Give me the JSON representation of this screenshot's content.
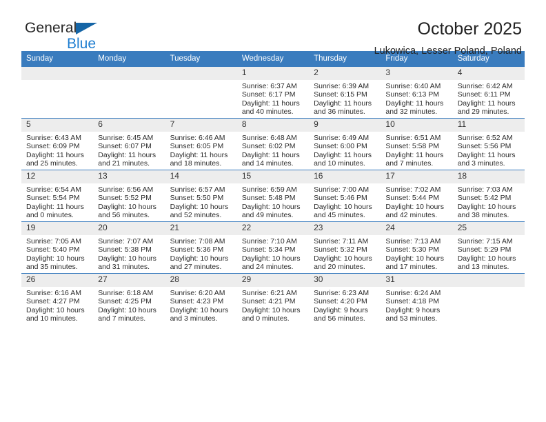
{
  "brand": {
    "name_top": "General",
    "name_bottom": "Blue",
    "triangle_color": "#1565a6",
    "blue_color": "#1f7ed0"
  },
  "header": {
    "title": "October 2025",
    "subtitle": "Lukowica, Lesser Poland, Poland"
  },
  "theme": {
    "header_bg": "#3a7cbe",
    "header_text": "#ffffff",
    "daynum_band_bg": "#ededed",
    "grid_line": "#3a7cbe"
  },
  "calendar": {
    "weekday_headers": [
      "Sunday",
      "Monday",
      "Tuesday",
      "Wednesday",
      "Thursday",
      "Friday",
      "Saturday"
    ],
    "weeks": [
      [
        {
          "day": "",
          "empty": true,
          "sunrise": "",
          "sunset": "",
          "daylight_line1": "",
          "daylight_line2": ""
        },
        {
          "day": "",
          "empty": true,
          "sunrise": "",
          "sunset": "",
          "daylight_line1": "",
          "daylight_line2": ""
        },
        {
          "day": "",
          "empty": true,
          "sunrise": "",
          "sunset": "",
          "daylight_line1": "",
          "daylight_line2": ""
        },
        {
          "day": "1",
          "empty": false,
          "sunrise": "Sunrise: 6:37 AM",
          "sunset": "Sunset: 6:17 PM",
          "daylight_line1": "Daylight: 11 hours",
          "daylight_line2": "and 40 minutes."
        },
        {
          "day": "2",
          "empty": false,
          "sunrise": "Sunrise: 6:39 AM",
          "sunset": "Sunset: 6:15 PM",
          "daylight_line1": "Daylight: 11 hours",
          "daylight_line2": "and 36 minutes."
        },
        {
          "day": "3",
          "empty": false,
          "sunrise": "Sunrise: 6:40 AM",
          "sunset": "Sunset: 6:13 PM",
          "daylight_line1": "Daylight: 11 hours",
          "daylight_line2": "and 32 minutes."
        },
        {
          "day": "4",
          "empty": false,
          "sunrise": "Sunrise: 6:42 AM",
          "sunset": "Sunset: 6:11 PM",
          "daylight_line1": "Daylight: 11 hours",
          "daylight_line2": "and 29 minutes."
        }
      ],
      [
        {
          "day": "5",
          "empty": false,
          "sunrise": "Sunrise: 6:43 AM",
          "sunset": "Sunset: 6:09 PM",
          "daylight_line1": "Daylight: 11 hours",
          "daylight_line2": "and 25 minutes."
        },
        {
          "day": "6",
          "empty": false,
          "sunrise": "Sunrise: 6:45 AM",
          "sunset": "Sunset: 6:07 PM",
          "daylight_line1": "Daylight: 11 hours",
          "daylight_line2": "and 21 minutes."
        },
        {
          "day": "7",
          "empty": false,
          "sunrise": "Sunrise: 6:46 AM",
          "sunset": "Sunset: 6:05 PM",
          "daylight_line1": "Daylight: 11 hours",
          "daylight_line2": "and 18 minutes."
        },
        {
          "day": "8",
          "empty": false,
          "sunrise": "Sunrise: 6:48 AM",
          "sunset": "Sunset: 6:02 PM",
          "daylight_line1": "Daylight: 11 hours",
          "daylight_line2": "and 14 minutes."
        },
        {
          "day": "9",
          "empty": false,
          "sunrise": "Sunrise: 6:49 AM",
          "sunset": "Sunset: 6:00 PM",
          "daylight_line1": "Daylight: 11 hours",
          "daylight_line2": "and 10 minutes."
        },
        {
          "day": "10",
          "empty": false,
          "sunrise": "Sunrise: 6:51 AM",
          "sunset": "Sunset: 5:58 PM",
          "daylight_line1": "Daylight: 11 hours",
          "daylight_line2": "and 7 minutes."
        },
        {
          "day": "11",
          "empty": false,
          "sunrise": "Sunrise: 6:52 AM",
          "sunset": "Sunset: 5:56 PM",
          "daylight_line1": "Daylight: 11 hours",
          "daylight_line2": "and 3 minutes."
        }
      ],
      [
        {
          "day": "12",
          "empty": false,
          "sunrise": "Sunrise: 6:54 AM",
          "sunset": "Sunset: 5:54 PM",
          "daylight_line1": "Daylight: 11 hours",
          "daylight_line2": "and 0 minutes."
        },
        {
          "day": "13",
          "empty": false,
          "sunrise": "Sunrise: 6:56 AM",
          "sunset": "Sunset: 5:52 PM",
          "daylight_line1": "Daylight: 10 hours",
          "daylight_line2": "and 56 minutes."
        },
        {
          "day": "14",
          "empty": false,
          "sunrise": "Sunrise: 6:57 AM",
          "sunset": "Sunset: 5:50 PM",
          "daylight_line1": "Daylight: 10 hours",
          "daylight_line2": "and 52 minutes."
        },
        {
          "day": "15",
          "empty": false,
          "sunrise": "Sunrise: 6:59 AM",
          "sunset": "Sunset: 5:48 PM",
          "daylight_line1": "Daylight: 10 hours",
          "daylight_line2": "and 49 minutes."
        },
        {
          "day": "16",
          "empty": false,
          "sunrise": "Sunrise: 7:00 AM",
          "sunset": "Sunset: 5:46 PM",
          "daylight_line1": "Daylight: 10 hours",
          "daylight_line2": "and 45 minutes."
        },
        {
          "day": "17",
          "empty": false,
          "sunrise": "Sunrise: 7:02 AM",
          "sunset": "Sunset: 5:44 PM",
          "daylight_line1": "Daylight: 10 hours",
          "daylight_line2": "and 42 minutes."
        },
        {
          "day": "18",
          "empty": false,
          "sunrise": "Sunrise: 7:03 AM",
          "sunset": "Sunset: 5:42 PM",
          "daylight_line1": "Daylight: 10 hours",
          "daylight_line2": "and 38 minutes."
        }
      ],
      [
        {
          "day": "19",
          "empty": false,
          "sunrise": "Sunrise: 7:05 AM",
          "sunset": "Sunset: 5:40 PM",
          "daylight_line1": "Daylight: 10 hours",
          "daylight_line2": "and 35 minutes."
        },
        {
          "day": "20",
          "empty": false,
          "sunrise": "Sunrise: 7:07 AM",
          "sunset": "Sunset: 5:38 PM",
          "daylight_line1": "Daylight: 10 hours",
          "daylight_line2": "and 31 minutes."
        },
        {
          "day": "21",
          "empty": false,
          "sunrise": "Sunrise: 7:08 AM",
          "sunset": "Sunset: 5:36 PM",
          "daylight_line1": "Daylight: 10 hours",
          "daylight_line2": "and 27 minutes."
        },
        {
          "day": "22",
          "empty": false,
          "sunrise": "Sunrise: 7:10 AM",
          "sunset": "Sunset: 5:34 PM",
          "daylight_line1": "Daylight: 10 hours",
          "daylight_line2": "and 24 minutes."
        },
        {
          "day": "23",
          "empty": false,
          "sunrise": "Sunrise: 7:11 AM",
          "sunset": "Sunset: 5:32 PM",
          "daylight_line1": "Daylight: 10 hours",
          "daylight_line2": "and 20 minutes."
        },
        {
          "day": "24",
          "empty": false,
          "sunrise": "Sunrise: 7:13 AM",
          "sunset": "Sunset: 5:30 PM",
          "daylight_line1": "Daylight: 10 hours",
          "daylight_line2": "and 17 minutes."
        },
        {
          "day": "25",
          "empty": false,
          "sunrise": "Sunrise: 7:15 AM",
          "sunset": "Sunset: 5:29 PM",
          "daylight_line1": "Daylight: 10 hours",
          "daylight_line2": "and 13 minutes."
        }
      ],
      [
        {
          "day": "26",
          "empty": false,
          "sunrise": "Sunrise: 6:16 AM",
          "sunset": "Sunset: 4:27 PM",
          "daylight_line1": "Daylight: 10 hours",
          "daylight_line2": "and 10 minutes."
        },
        {
          "day": "27",
          "empty": false,
          "sunrise": "Sunrise: 6:18 AM",
          "sunset": "Sunset: 4:25 PM",
          "daylight_line1": "Daylight: 10 hours",
          "daylight_line2": "and 7 minutes."
        },
        {
          "day": "28",
          "empty": false,
          "sunrise": "Sunrise: 6:20 AM",
          "sunset": "Sunset: 4:23 PM",
          "daylight_line1": "Daylight: 10 hours",
          "daylight_line2": "and 3 minutes."
        },
        {
          "day": "29",
          "empty": false,
          "sunrise": "Sunrise: 6:21 AM",
          "sunset": "Sunset: 4:21 PM",
          "daylight_line1": "Daylight: 10 hours",
          "daylight_line2": "and 0 minutes."
        },
        {
          "day": "30",
          "empty": false,
          "sunrise": "Sunrise: 6:23 AM",
          "sunset": "Sunset: 4:20 PM",
          "daylight_line1": "Daylight: 9 hours",
          "daylight_line2": "and 56 minutes."
        },
        {
          "day": "31",
          "empty": false,
          "sunrise": "Sunrise: 6:24 AM",
          "sunset": "Sunset: 4:18 PM",
          "daylight_line1": "Daylight: 9 hours",
          "daylight_line2": "and 53 minutes."
        },
        {
          "day": "",
          "empty": true,
          "sunrise": "",
          "sunset": "",
          "daylight_line1": "",
          "daylight_line2": ""
        }
      ]
    ]
  }
}
